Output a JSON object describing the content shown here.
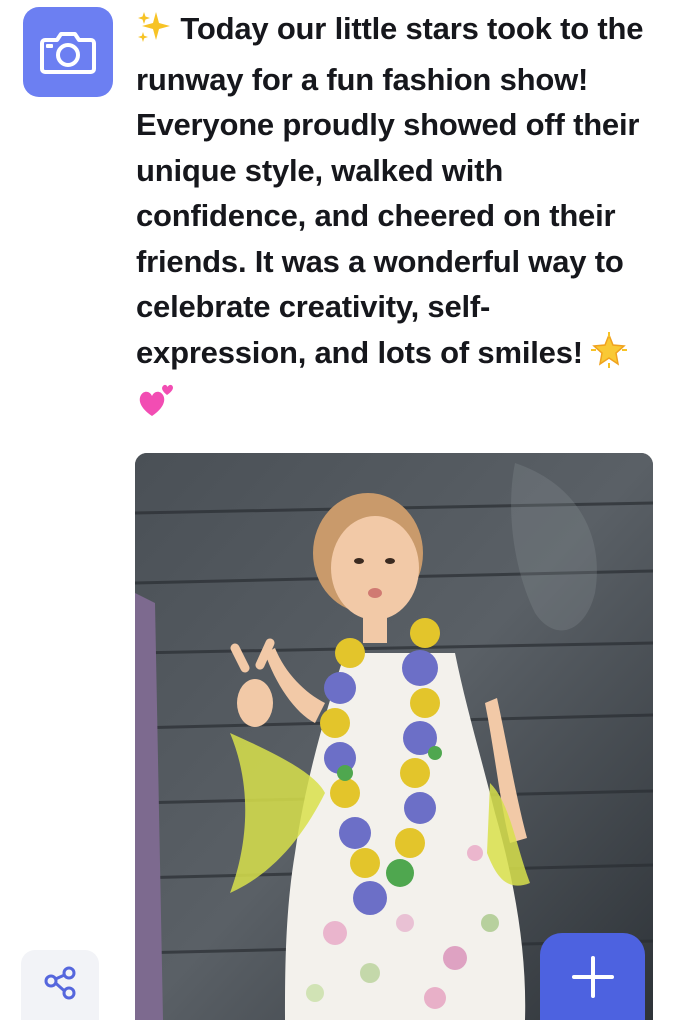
{
  "post": {
    "text": "Today our little stars took to the runway for a fun fashion show! Everyone proudly showed off their unique style, walked with confidence, and cheered on their friends. It was a wonderful way to celebrate creativity, self-expression, and lots of smiles!",
    "leading_emoji": "sparkles-emoji",
    "trailing_emojis": [
      "glowing-star-emoji",
      "two-hearts-emoji"
    ]
  },
  "buttons": {
    "camera_icon": "camera-icon",
    "share_icon": "share-icon",
    "add_icon": "plus-icon"
  },
  "colors": {
    "camera_button": "#6c7ff2",
    "add_button": "#4d62e0",
    "share_button_bg": "#f2f3f7",
    "text": "#16171c"
  }
}
